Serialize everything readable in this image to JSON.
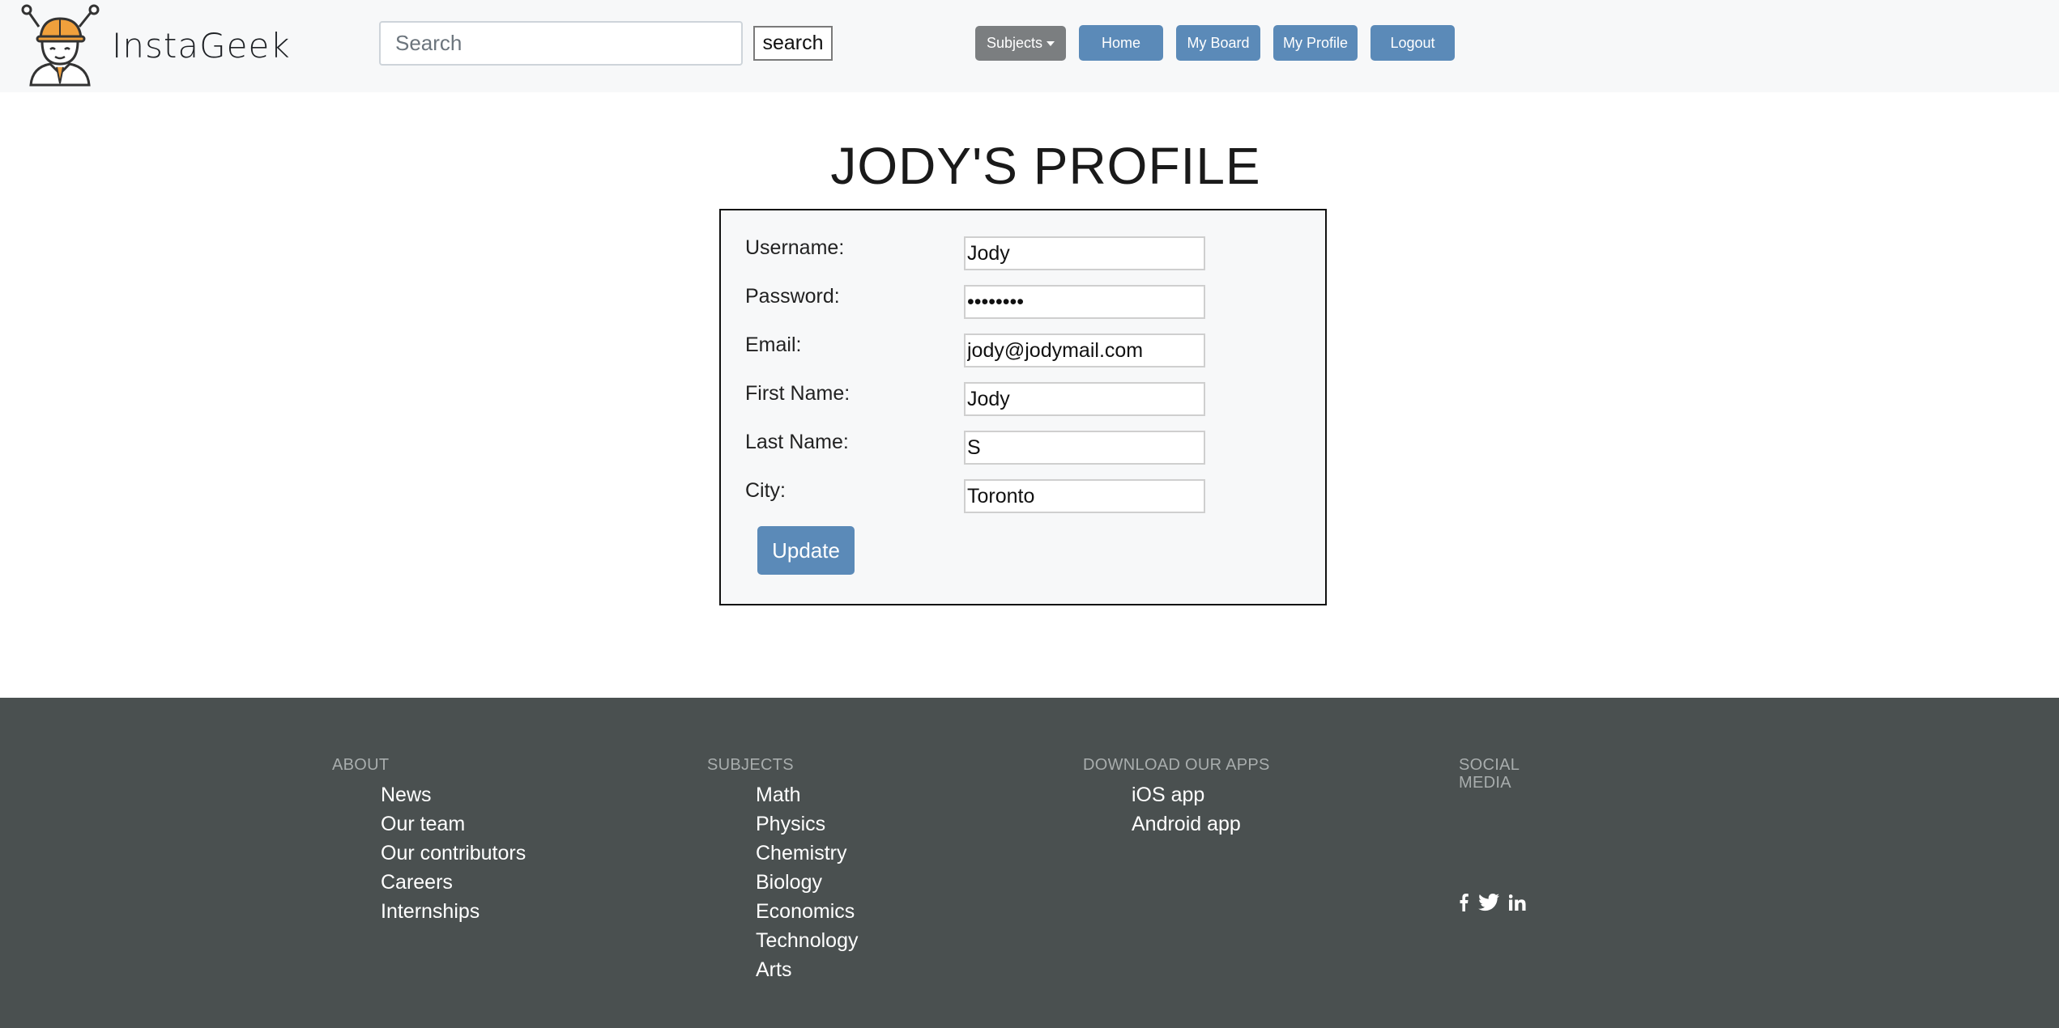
{
  "brand": {
    "name": "InstaGeek"
  },
  "search": {
    "placeholder": "Search",
    "button_label": "search"
  },
  "nav": {
    "subjects_label": "Subjects",
    "home_label": "Home",
    "board_label": "My Board",
    "profile_label": "My Profile",
    "logout_label": "Logout"
  },
  "profile": {
    "title": "JODY'S PROFILE",
    "fields": [
      {
        "label": "Username:",
        "value": "Jody"
      },
      {
        "label": "Password:",
        "value": "••••••••"
      },
      {
        "label": "Email:",
        "value": "jody@jodymail.com"
      },
      {
        "label": "First Name:",
        "value": "Jody"
      },
      {
        "label": "Last Name:",
        "value": "S"
      },
      {
        "label": "City:",
        "value": "Toronto"
      }
    ],
    "update_label": "Update"
  },
  "footer": {
    "about": {
      "heading": "About",
      "items": [
        "News",
        "Our team",
        "Our contributors",
        "Careers",
        "Internships"
      ]
    },
    "subjects": {
      "heading": "Subjects",
      "items": [
        "Math",
        "Physics",
        "Chemistry",
        "Biology",
        "Economics",
        "Technology",
        "Arts"
      ]
    },
    "apps": {
      "heading": "Download our apps",
      "items": [
        "iOS app",
        "Android app"
      ]
    },
    "social": {
      "heading_line1": "Social",
      "heading_line2": "Media",
      "icons": [
        "facebook-icon",
        "twitter-icon",
        "linkedin-icon"
      ]
    }
  },
  "colors": {
    "accent": "#5b8ab8",
    "nav_dark_button": "#7b7e80",
    "footer_bg": "#4a5050",
    "navbar_bg": "#f7f8f9"
  }
}
